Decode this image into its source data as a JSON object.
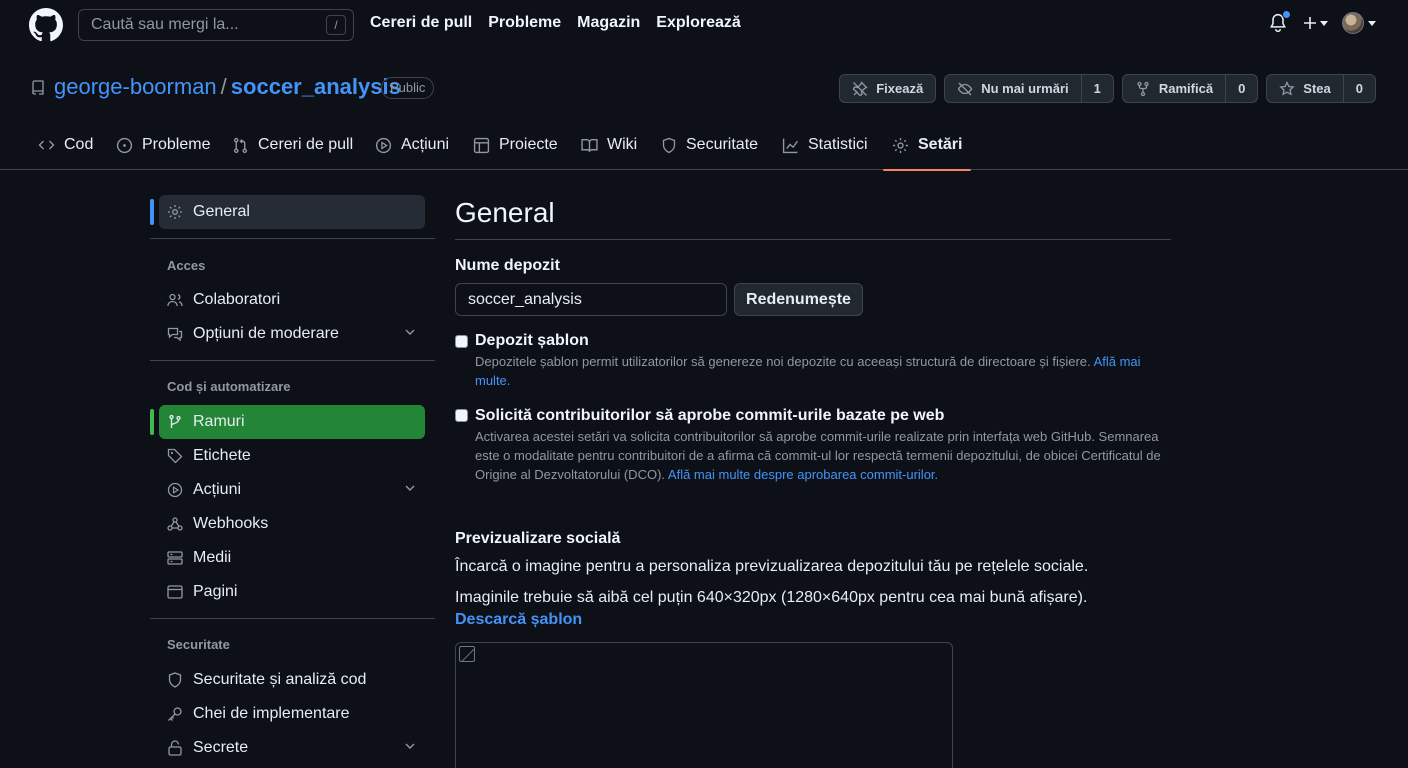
{
  "header": {
    "search_placeholder": "Caută sau mergi la...",
    "search_shortcut": "/",
    "nav": [
      "Cereri de pull",
      "Probleme",
      "Magazin",
      "Explorează"
    ],
    "notification_dot_color": "#4493f8"
  },
  "repo": {
    "owner": "george-boorman",
    "separator": "/",
    "name": "soccer_analysis",
    "visibility": "Public",
    "actions": {
      "pin": "Fixează",
      "unwatch": "Nu mai urmări",
      "watch_count": "1",
      "fork": "Ramifică",
      "fork_count": "0",
      "star": "Stea",
      "star_count": "0"
    }
  },
  "tabs": [
    "Cod",
    "Probleme",
    "Cereri de pull",
    "Acțiuni",
    "Proiecte",
    "Wiki",
    "Securitate",
    "Statistici",
    "Setări"
  ],
  "active_tab": "Setări",
  "sidebar": {
    "general": "General",
    "access_heading": "Acces",
    "collaborators": "Colaboratori",
    "moderation": "Opțiuni de moderare",
    "code_heading": "Cod și automatizare",
    "branches": "Ramuri",
    "tags": "Etichete",
    "actions": "Acțiuni",
    "webhooks": "Webhooks",
    "environments": "Medii",
    "pages": "Pagini",
    "security_heading": "Securitate",
    "security_analysis": "Securitate și analiză cod",
    "deploy_keys": "Chei de implementare",
    "secrets": "Secrete"
  },
  "main": {
    "title": "General",
    "repo_name_label": "Nume depozit",
    "repo_name_value": "soccer_analysis",
    "rename_button": "Redenumește",
    "template": {
      "title": "Depozit șablon",
      "desc": "Depozitele șablon permit utilizatorilor să genereze noi depozite cu aceeași structură de directoare și fișiere.",
      "link": "Află mai multe."
    },
    "signoff": {
      "title": "Solicită contribuitorilor să aprobe commit-urile bazate pe web",
      "desc": "Activarea acestei setări va solicita contribuitorilor să aprobe commit-urile realizate prin interfața web GitHub. Semnarea este o modalitate pentru contribuitori de a afirma că commit-ul lor respectă termenii depozitului, de obicei Certificatul de Origine al Dezvoltatorului (DCO).",
      "link": "Află mai multe despre aprobarea commit-urilor."
    },
    "social": {
      "title": "Previzualizare socială",
      "line1": "Încarcă o imagine pentru a personaliza previzualizarea depozitului tău pe rețelele sociale.",
      "line2": "Imaginile trebuie să aibă cel puțin 640×320px (1280×640px pentru cea mai bună afișare).",
      "download": "Descarcă șablon"
    }
  }
}
